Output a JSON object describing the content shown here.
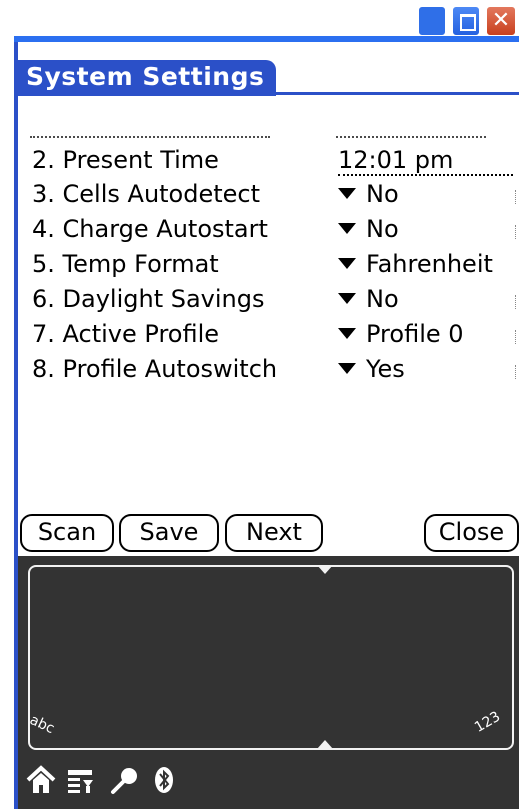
{
  "window": {
    "close_glyph": "✕",
    "accent": "#2b50c8",
    "xp_blue": "#2b6ff0"
  },
  "app": {
    "title": "System Settings"
  },
  "settings": [
    {
      "label": "2. Present Time",
      "value": "12:01 pm",
      "kind": "time"
    },
    {
      "label": "3. Cells Autodetect",
      "value": "No",
      "kind": "dropdown"
    },
    {
      "label": "4. Charge Autostart",
      "value": "No",
      "kind": "dropdown"
    },
    {
      "label": "5. Temp Format",
      "value": "Fahrenheit",
      "kind": "dropdown"
    },
    {
      "label": "6. Daylight Savings",
      "value": "No",
      "kind": "dropdown"
    },
    {
      "label": "7. Active Profile",
      "value": "Profile 0",
      "kind": "dropdown"
    },
    {
      "label": "8. Profile Autoswitch",
      "value": "Yes",
      "kind": "dropdown"
    }
  ],
  "buttons": {
    "scan": "Scan",
    "save": "Save",
    "next": "Next",
    "close": "Close"
  },
  "graffiti": {
    "abc_label": "abc",
    "num_label": "123",
    "icons": [
      "home-icon",
      "menu-icon",
      "find-icon",
      "bluetooth-icon"
    ]
  }
}
